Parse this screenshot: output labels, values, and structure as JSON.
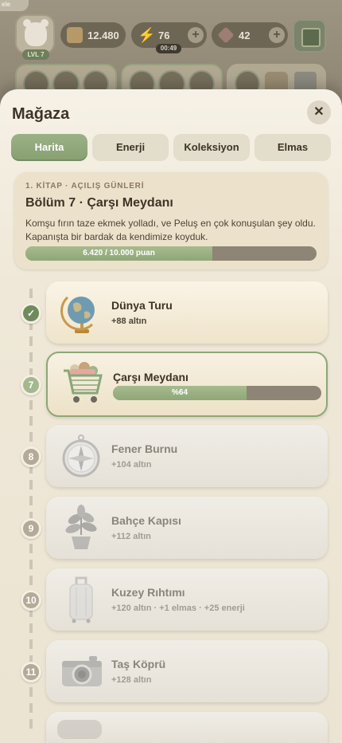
{
  "hud": {
    "corner_label": "ele",
    "level": "LVL 7",
    "coins": "12.480",
    "energy": "76",
    "energy_timer": "00:49",
    "gems": "42",
    "plus_symbol": "+"
  },
  "shop": {
    "title": "Mağaza",
    "close_symbol": "✕",
    "tabs": [
      {
        "label": "Harita",
        "active": true
      },
      {
        "label": "Enerji",
        "active": false
      },
      {
        "label": "Koleksiyon",
        "active": false
      },
      {
        "label": "Elmas",
        "active": false
      }
    ],
    "book": {
      "kicker": "1. KİTAP · AÇILIŞ GÜNLERİ",
      "title": "Bölüm 7 · Çarşı Meydanı",
      "description": "Komşu fırın taze ekmek yolladı, ve Peluş en çok konuşulan şey oldu. Kapanışta bir bardak da kendimize koyduk.",
      "progress_text": "6.420 / 10.000 puan",
      "progress_fraction": 0.642
    },
    "stages": [
      {
        "step": "✓",
        "state": "done",
        "name": "Dünya Turu",
        "reward": "+88 altın",
        "icon": "globe-icon"
      },
      {
        "step": "7",
        "state": "current",
        "name": "Çarşı Meydanı",
        "progress_text": "%64",
        "progress_fraction": 0.64,
        "icon": "shopping-cart-icon"
      },
      {
        "step": "8",
        "state": "locked",
        "name": "Fener Burnu",
        "reward": "+104 altın",
        "icon": "compass-icon"
      },
      {
        "step": "9",
        "state": "locked",
        "name": "Bahçe Kapısı",
        "reward": "+112 altın",
        "icon": "potted-plant-icon"
      },
      {
        "step": "10",
        "state": "locked",
        "name": "Kuzey Rıhtımı",
        "reward": "+120 altın · +1 elmas · +25 enerji",
        "icon": "suitcase-icon"
      },
      {
        "step": "11",
        "state": "locked",
        "name": "Taş Köprü",
        "reward": "+128 altın",
        "icon": "camera-icon"
      }
    ]
  },
  "colors": {
    "accent_green": "#8fa777",
    "progress_track": "#8e8576",
    "title_text": "#3d3326"
  }
}
